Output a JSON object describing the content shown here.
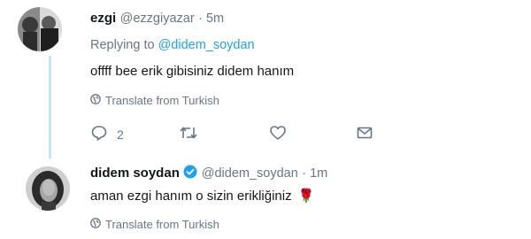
{
  "tweet1": {
    "name": "ezgi",
    "handle": "@ezzgiyazar",
    "time": "· 5m",
    "reply_prefix": "Replying to",
    "reply_to": "@didem_soydan",
    "text": "offff bee erik gibisiniz didem hanım",
    "translate": "Translate from Turkish",
    "actions": {
      "reply_count": "2",
      "reply_icon": "reply-icon",
      "retweet_icon": "retweet-icon",
      "like_icon": "heart-icon",
      "dm_icon": "envelope-icon"
    }
  },
  "tweet2": {
    "name": "didem soydan",
    "handle": "@didem_soydan",
    "time": "· 1m",
    "text": "aman ezgi hanım o sizin erikliğiniz",
    "emoji": "🌹",
    "translate": "Translate from Turkish"
  },
  "colors": {
    "link": "#1da1f2",
    "muted": "#657786",
    "thread_line": "#c4e6f4",
    "verified": "#1da1f2"
  }
}
